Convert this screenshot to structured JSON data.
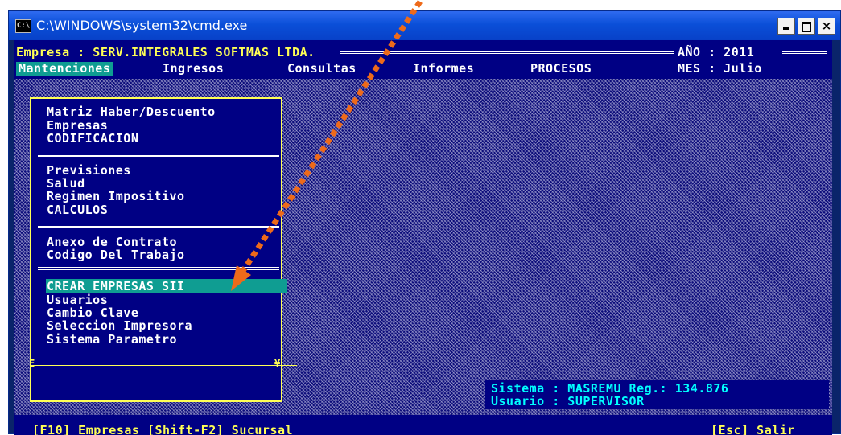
{
  "window": {
    "title": "C:\\WINDOWS\\system32\\cmd.exe",
    "icon_text": "C:\\"
  },
  "header": {
    "company": "Empresa : SERV.INTEGRALES SOFTMAS LTDA.",
    "year": "AÑO : 2011",
    "month": "MES : Julio"
  },
  "menubar": {
    "items": [
      {
        "label": "Mantenciones",
        "active": true
      },
      {
        "label": "Ingresos"
      },
      {
        "label": "Consultas"
      },
      {
        "label": "Informes"
      },
      {
        "label": "PROCESOS"
      }
    ]
  },
  "dropdown": {
    "groups": [
      [
        "Matriz Haber/Descuento",
        "Empresas",
        "CODIFICACION"
      ],
      [
        "Previsiones",
        "Salud",
        "Regimen Impositivo",
        "CALCULOS"
      ],
      [
        "Anexo de Contrato",
        "Codigo Del Trabajo"
      ],
      [
        "CREAR EMPRESAS SII",
        "Usuarios",
        "Cambio Clave",
        "Seleccion Impresora",
        "Sistema Parametro"
      ]
    ],
    "selected": "CREAR EMPRESAS SII",
    "corner_left": "E",
    "corner_right": "¥"
  },
  "status": {
    "line1": "Sistema : MASREMU Reg.: 134.876",
    "line2": "Usuario : SUPERVISOR"
  },
  "footer": {
    "fkeys": "[F10] Empresas [Shift-F2] Sucursal",
    "esc": "[Esc] Salir"
  },
  "colors": {
    "console_bg": "#000084",
    "highlight": "#0f9d92",
    "yellow": "#ffff55",
    "cyan": "#00ffff",
    "arrow": "#ee6a1a"
  }
}
